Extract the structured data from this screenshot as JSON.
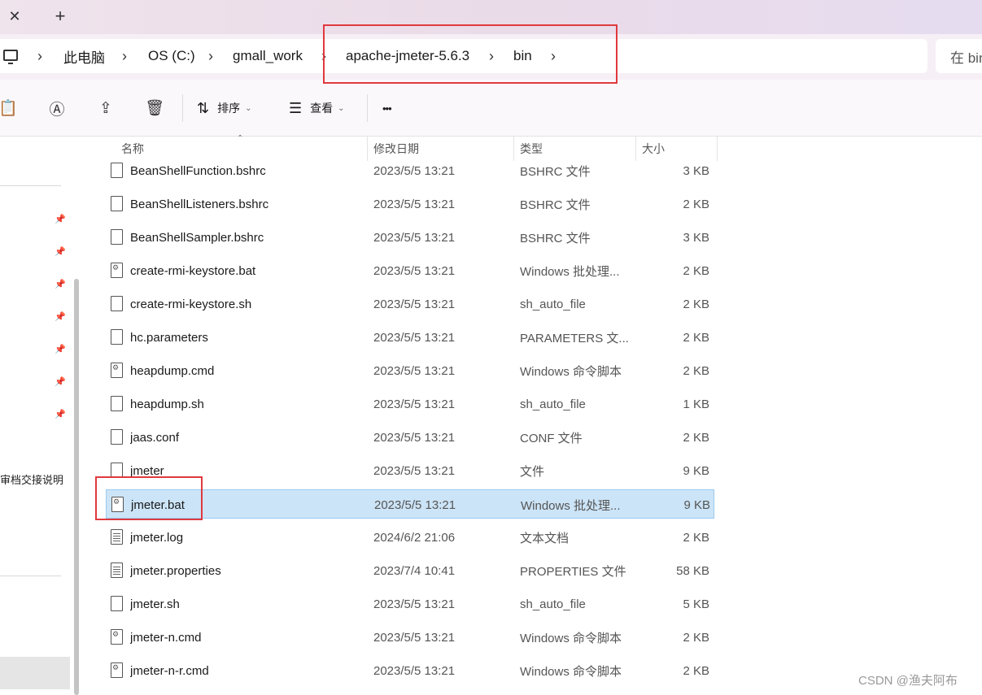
{
  "tabbar": {
    "close_label": "✕",
    "new_tab_label": "+"
  },
  "breadcrumb": {
    "items": [
      "此电脑",
      "OS (C:)",
      "gmall_work",
      "apache-jmeter-5.6.3",
      "bin"
    ],
    "separator": "›"
  },
  "search": {
    "placeholder": "在 bin"
  },
  "toolbar": {
    "sort_label": "排序",
    "view_label": "查看",
    "more_label": "•••"
  },
  "nav": {
    "partial_label": "审档交接说明"
  },
  "columns": {
    "name": "名称",
    "date": "修改日期",
    "type": "类型",
    "size": "大小"
  },
  "files": [
    {
      "name": "BeanShellFunction.bshrc",
      "date": "2023/5/5 13:21",
      "type": "BSHRC 文件",
      "size": "3 KB",
      "icon": "file-icon"
    },
    {
      "name": "BeanShellListeners.bshrc",
      "date": "2023/5/5 13:21",
      "type": "BSHRC 文件",
      "size": "2 KB",
      "icon": "file-icon"
    },
    {
      "name": "BeanShellSampler.bshrc",
      "date": "2023/5/5 13:21",
      "type": "BSHRC 文件",
      "size": "3 KB",
      "icon": "file-icon"
    },
    {
      "name": "create-rmi-keystore.bat",
      "date": "2023/5/5 13:21",
      "type": "Windows 批处理...",
      "size": "2 KB",
      "icon": "script-file-icon"
    },
    {
      "name": "create-rmi-keystore.sh",
      "date": "2023/5/5 13:21",
      "type": "sh_auto_file",
      "size": "2 KB",
      "icon": "file-icon"
    },
    {
      "name": "hc.parameters",
      "date": "2023/5/5 13:21",
      "type": "PARAMETERS 文...",
      "size": "2 KB",
      "icon": "file-icon"
    },
    {
      "name": "heapdump.cmd",
      "date": "2023/5/5 13:21",
      "type": "Windows 命令脚本",
      "size": "2 KB",
      "icon": "script-file-icon"
    },
    {
      "name": "heapdump.sh",
      "date": "2023/5/5 13:21",
      "type": "sh_auto_file",
      "size": "1 KB",
      "icon": "file-icon"
    },
    {
      "name": "jaas.conf",
      "date": "2023/5/5 13:21",
      "type": "CONF 文件",
      "size": "2 KB",
      "icon": "file-icon"
    },
    {
      "name": "jmeter",
      "date": "2023/5/5 13:21",
      "type": "文件",
      "size": "9 KB",
      "icon": "file-icon"
    },
    {
      "name": "jmeter.bat",
      "date": "2023/5/5 13:21",
      "type": "Windows 批处理...",
      "size": "9 KB",
      "icon": "script-file-icon",
      "selected": true
    },
    {
      "name": "jmeter.log",
      "date": "2024/6/2 21:06",
      "type": "文本文档",
      "size": "2 KB",
      "icon": "text-file-icon"
    },
    {
      "name": "jmeter.properties",
      "date": "2023/7/4 10:41",
      "type": "PROPERTIES 文件",
      "size": "58 KB",
      "icon": "text-file-icon"
    },
    {
      "name": "jmeter.sh",
      "date": "2023/5/5 13:21",
      "type": "sh_auto_file",
      "size": "5 KB",
      "icon": "file-icon"
    },
    {
      "name": "jmeter-n.cmd",
      "date": "2023/5/5 13:21",
      "type": "Windows 命令脚本",
      "size": "2 KB",
      "icon": "script-file-icon"
    },
    {
      "name": "jmeter-n-r.cmd",
      "date": "2023/5/5 13:21",
      "type": "Windows 命令脚本",
      "size": "2 KB",
      "icon": "script-file-icon"
    }
  ],
  "watermark": "CSDN @渔夫阿布",
  "colors": {
    "selection_bg": "#cce4f7",
    "highlight_box": "#e0393e"
  }
}
